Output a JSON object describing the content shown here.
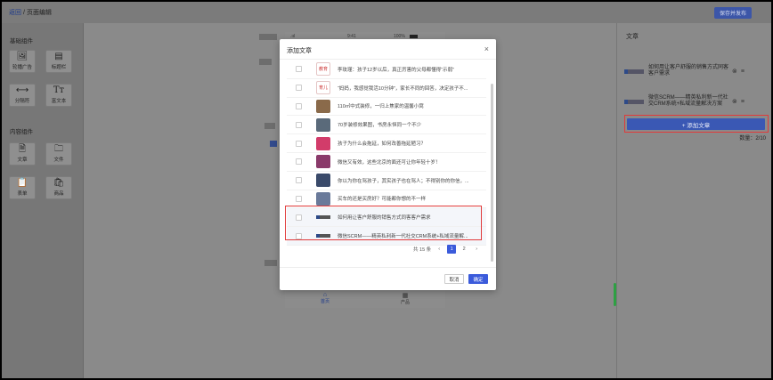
{
  "header": {
    "breadcrumb_link": "返回",
    "breadcrumb_sep": "/",
    "breadcrumb_current": "页面编辑",
    "save_label": "保存并发布"
  },
  "left_panel": {
    "basic_title": "基础组件",
    "basic_items": [
      {
        "label": "轮播广告",
        "icon": "image-icon"
      },
      {
        "label": "标题栏",
        "icon": "title-bar-icon"
      },
      {
        "label": "分隔符",
        "icon": "divider-icon"
      },
      {
        "label": "富文本",
        "icon": "rich-text-icon"
      }
    ],
    "content_title": "内容组件",
    "content_items": [
      {
        "label": "文章",
        "icon": "article-icon"
      },
      {
        "label": "文件",
        "icon": "folder-icon"
      },
      {
        "label": "表单",
        "icon": "form-icon"
      },
      {
        "label": "商品",
        "icon": "bag-icon"
      }
    ]
  },
  "canvas": {
    "status_time": "9:41",
    "status_battery": "100%",
    "tabs": [
      {
        "label": "首页",
        "active": true
      },
      {
        "label": "产品",
        "active": false
      }
    ]
  },
  "right_panel": {
    "title": "文章",
    "articles": [
      {
        "title": "如何用让客户舒服的销售方式同客客户需求"
      },
      {
        "title": "微信SCRM——精英私利新一代社交CRM系统+私域流量解决方案"
      }
    ],
    "add_label": "+ 添加文章",
    "count": "数量：2/10"
  },
  "modal": {
    "title": "添加文章",
    "close": "×",
    "rows": [
      {
        "title": "李玫瑾：孩子12岁以后，真正厉害的父母都懂得“示弱”",
        "thumb": "教育",
        "color": "#ffffff",
        "text_color": "#c33",
        "selected": false
      },
      {
        "title": "“妈妈，我感觉我活10分钟”，家长不同的回答，决定孩子不...",
        "thumb": "育儿",
        "color": "#ffffff",
        "text_color": "#c33",
        "selected": false
      },
      {
        "title": "110㎡中式装修，一归上焦家的温馨小窝",
        "thumb": "",
        "color": "#8a6a4a",
        "text_color": "#fff",
        "selected": false
      },
      {
        "title": "70岁装修效果图，书房永恒同一个不少",
        "thumb": "",
        "color": "#5a6a7a",
        "text_color": "#fff",
        "selected": false
      },
      {
        "title": "孩子为什么会拖延，如何改善拖延陋习？",
        "thumb": "",
        "color": "#d23c6a",
        "text_color": "#fff",
        "selected": false
      },
      {
        "title": "微信又有效，这些北京的面还可让你年轻十岁！",
        "thumb": "",
        "color": "#8a3a6a",
        "text_color": "#fff",
        "selected": false
      },
      {
        "title": "你以为你在骂孩子，其实孩子也在骂人；不得别你的你信，...",
        "thumb": "",
        "color": "#3a4a6a",
        "text_color": "#fff",
        "selected": false
      },
      {
        "title": "买车的还是买房好？可能都你想的不一样",
        "thumb": "",
        "color": "#6a7a9a",
        "text_color": "#fff",
        "selected": false
      },
      {
        "title": "如何用让客户舒服的销售方式同客客户需求",
        "thumb": "",
        "color": "",
        "text_color": "",
        "selected": true
      },
      {
        "title": "微信SCRM——精英私利新一代社交CRM系统+私域流量解...",
        "thumb": "",
        "color": "",
        "text_color": "",
        "selected": true
      }
    ],
    "pager": {
      "total": "共 15 条",
      "prev": "‹",
      "pages": [
        "1",
        "2"
      ],
      "current": "1",
      "next": "›"
    },
    "cancel_label": "取消",
    "ok_label": "确定"
  }
}
